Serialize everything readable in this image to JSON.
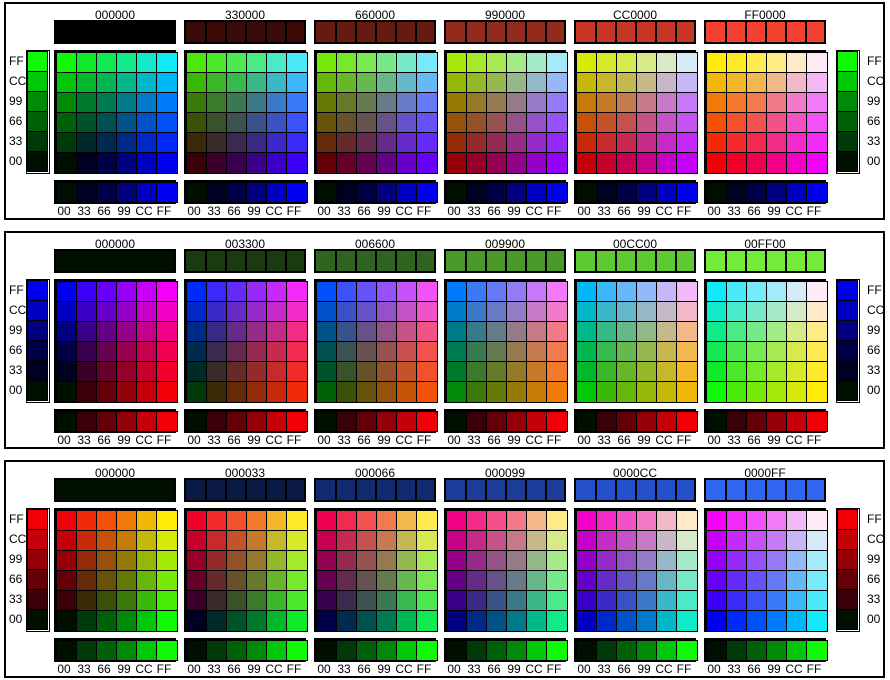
{
  "tick_labels": [
    "00",
    "33",
    "66",
    "99",
    "CC",
    "FF"
  ],
  "panels": [
    {
      "name": "red-panel",
      "palette_titles": [
        "000000",
        "330000",
        "660000",
        "990000",
        "CC0000",
        "FF0000"
      ],
      "base_colors": [
        "#000000",
        "#330000",
        "#660000",
        "#990000",
        "#CC0000",
        "#FF0000"
      ],
      "cube_fixed": "red",
      "row_channel": "green",
      "col_channel": "blue",
      "side_strip_channel": "green",
      "bottom_strip_channel": "blue",
      "display_colors": {
        "#000000": "#000000",
        "#330000": "#3a0a06",
        "#660000": "#661a10",
        "#990000": "#952a1a",
        "#CC0000": "#c63526",
        "#FF0000": "#f2432e",
        "#00FF00": "#74ea3a"
      }
    },
    {
      "name": "green-panel",
      "palette_titles": [
        "000000",
        "003300",
        "006600",
        "009900",
        "00CC00",
        "00FF00"
      ],
      "base_colors": [
        "#000000",
        "#003300",
        "#006600",
        "#009900",
        "#00CC00",
        "#00FF00"
      ],
      "cube_fixed": "green",
      "row_channel": "blue",
      "col_channel": "red",
      "side_strip_channel": "blue",
      "bottom_strip_channel": "red",
      "display_colors": {
        "#003300": "#1a3a10",
        "#006600": "#2e6520",
        "#009900": "#4a9a2a",
        "#00CC00": "#5fc934",
        "#00FF00": "#74ea3a"
      }
    },
    {
      "name": "blue-panel",
      "palette_titles": [
        "000000",
        "000033",
        "000066",
        "000099",
        "0000CC",
        "0000FF"
      ],
      "base_colors": [
        "#000000",
        "#000033",
        "#000066",
        "#000099",
        "#0000CC",
        "#0000FF"
      ],
      "cube_fixed": "blue",
      "row_channel": "red",
      "col_channel": "green",
      "side_strip_channel": "red",
      "bottom_strip_channel": "green",
      "display_colors": {
        "#000033": "#0a1a45",
        "#000066": "#10296f",
        "#000099": "#1b3c98",
        "#0000CC": "#2350c8",
        "#0000FF": "#3066f0"
      }
    }
  ]
}
